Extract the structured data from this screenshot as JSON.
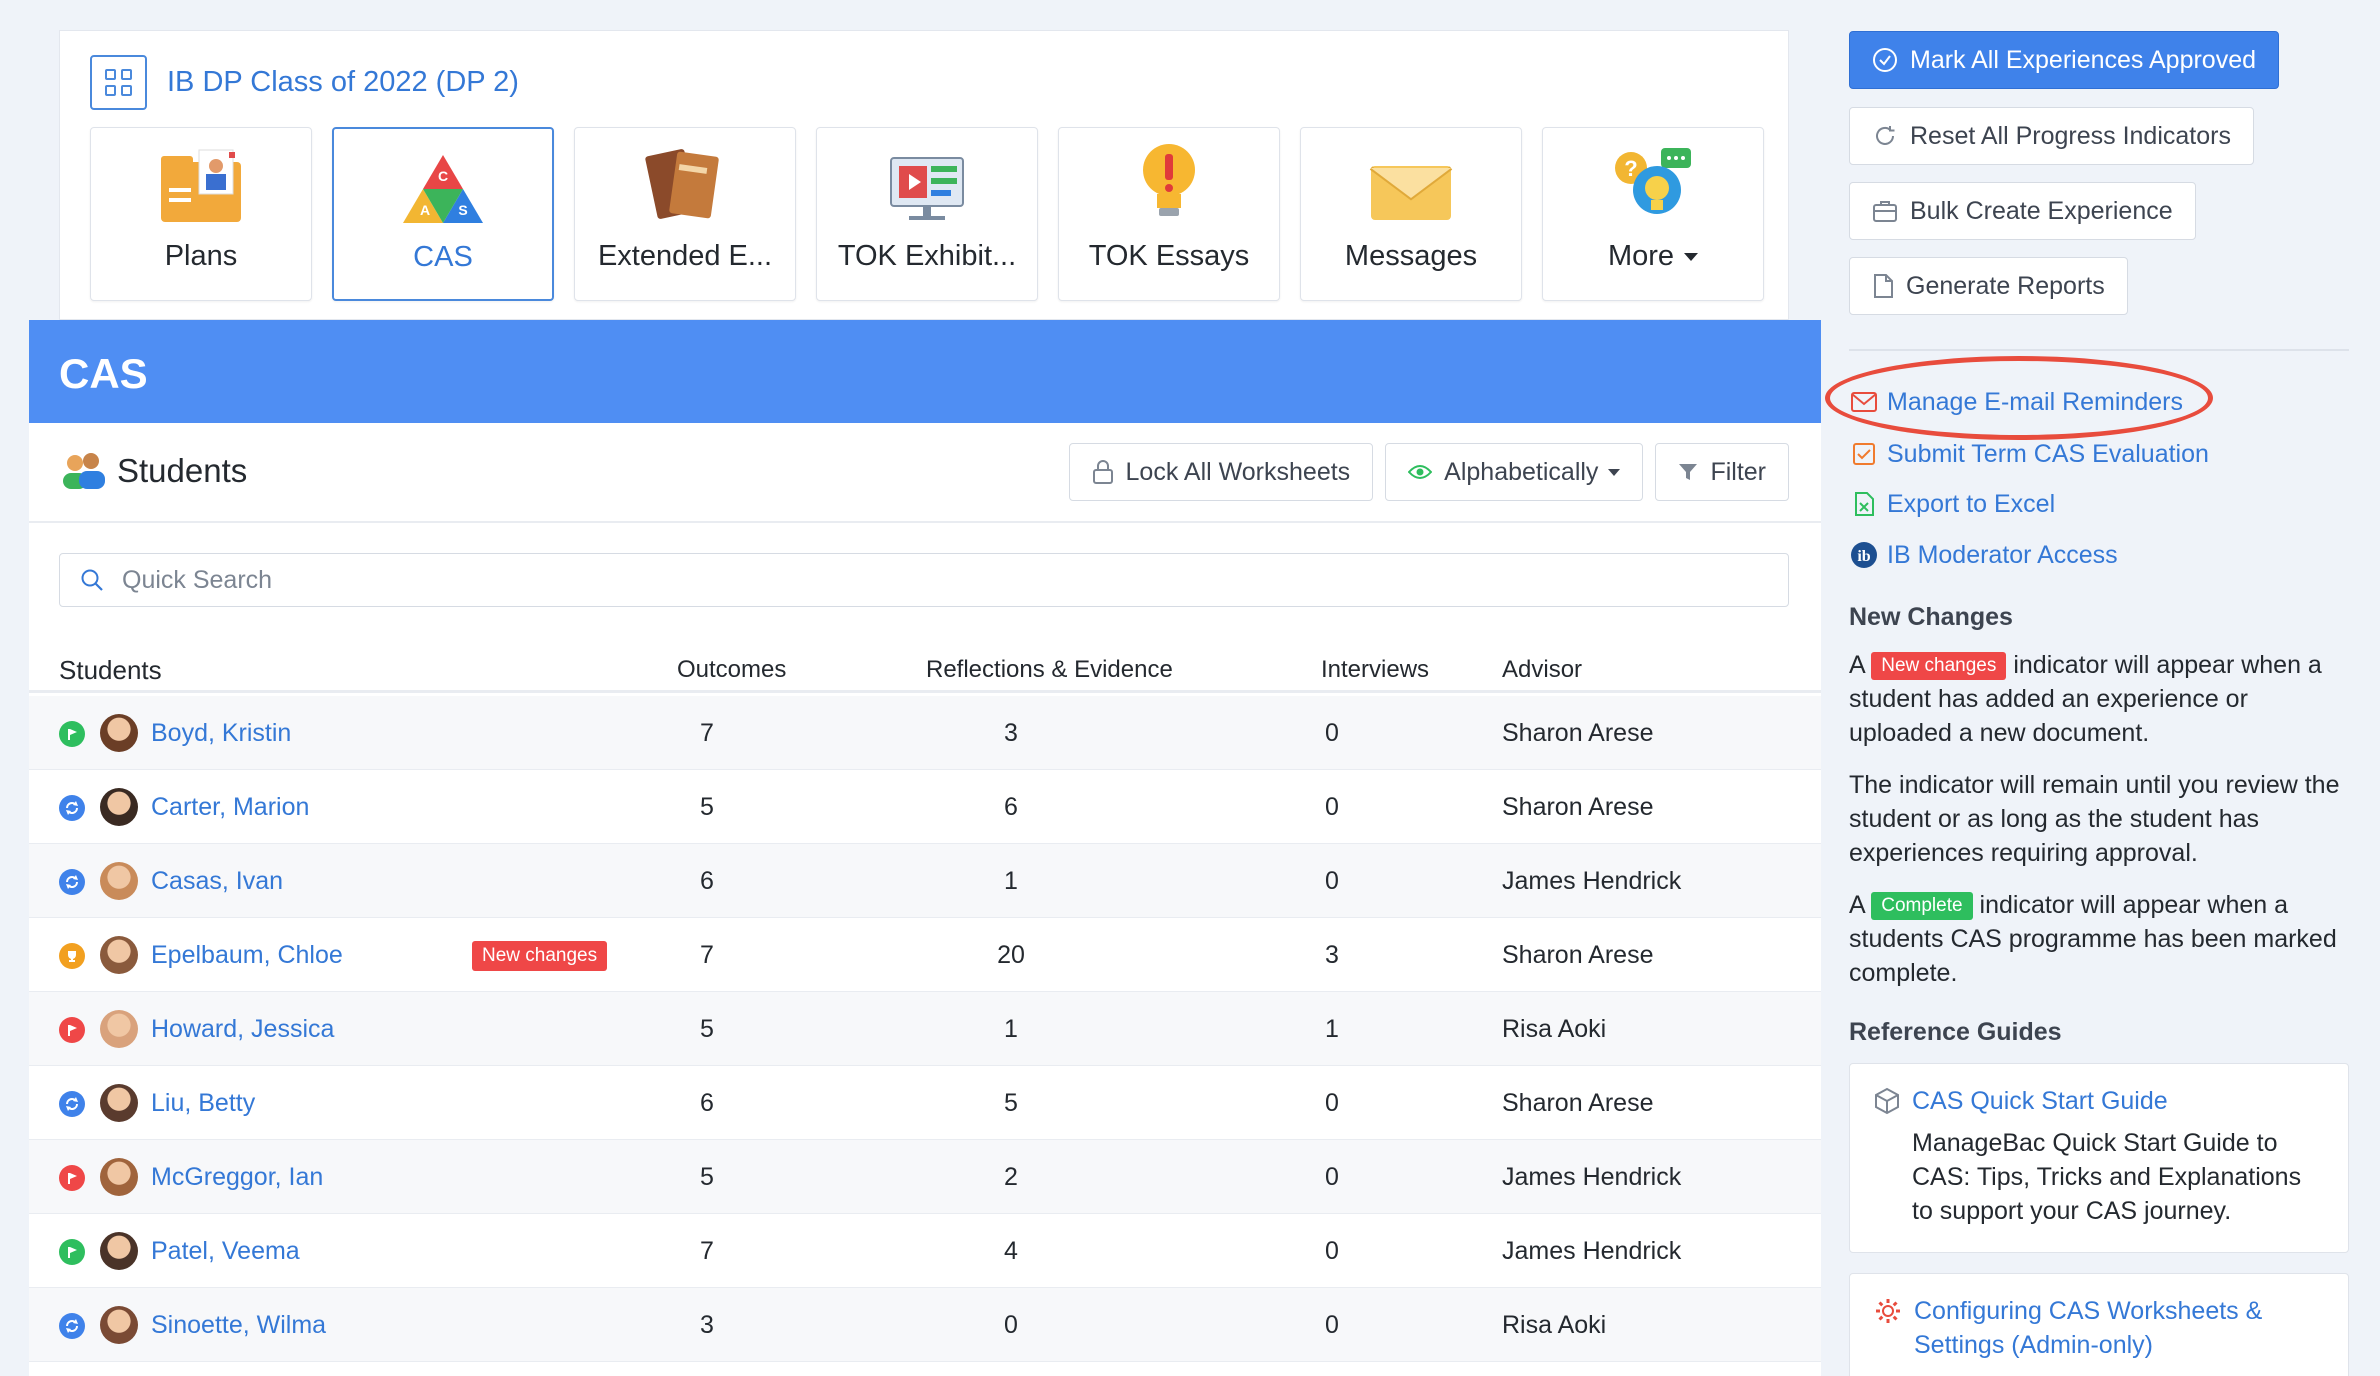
{
  "class": {
    "title": "IB DP Class of 2022 (DP 2)"
  },
  "tiles": [
    {
      "label": "Plans",
      "icon": "plans-folder-icon"
    },
    {
      "label": "CAS",
      "icon": "cas-triangle-icon"
    },
    {
      "label": "Extended E...",
      "icon": "extended-essay-books-icon"
    },
    {
      "label": "TOK Exhibit...",
      "icon": "tok-exhibition-screen-icon"
    },
    {
      "label": "TOK Essays",
      "icon": "lightbulb-icon"
    },
    {
      "label": "Messages",
      "icon": "envelope-icon"
    },
    {
      "label": "More",
      "icon": "question-bubble-icon"
    }
  ],
  "cas": {
    "title": "CAS",
    "students_heading": "Students",
    "toolbar": {
      "lock": "Lock All Worksheets",
      "sort": "Alphabetically",
      "filter": "Filter"
    },
    "search_placeholder": "Quick Search",
    "columns": {
      "students": "Students",
      "outcomes": "Outcomes",
      "reflections": "Reflections & Evidence",
      "interviews": "Interviews",
      "advisor": "Advisor"
    },
    "rows": [
      {
        "status": "green-flag",
        "name": "Boyd, Kristin",
        "badge": "",
        "outcomes": "7",
        "reflections": "3",
        "interviews": "0",
        "advisor": "Sharon Arese"
      },
      {
        "status": "blue-sync",
        "name": "Carter, Marion",
        "badge": "",
        "outcomes": "5",
        "reflections": "6",
        "interviews": "0",
        "advisor": "Sharon Arese"
      },
      {
        "status": "blue-sync",
        "name": "Casas, Ivan",
        "badge": "",
        "outcomes": "6",
        "reflections": "1",
        "interviews": "0",
        "advisor": "James Hendrick"
      },
      {
        "status": "orange-trophy",
        "name": "Epelbaum, Chloe",
        "badge": "New changes",
        "outcomes": "7",
        "reflections": "20",
        "interviews": "3",
        "advisor": "Sharon Arese"
      },
      {
        "status": "red-flag",
        "name": "Howard, Jessica",
        "badge": "",
        "outcomes": "5",
        "reflections": "1",
        "interviews": "1",
        "advisor": "Risa Aoki"
      },
      {
        "status": "blue-sync",
        "name": "Liu, Betty",
        "badge": "",
        "outcomes": "6",
        "reflections": "5",
        "interviews": "0",
        "advisor": "Sharon Arese"
      },
      {
        "status": "red-flag",
        "name": "McGreggor, Ian",
        "badge": "",
        "outcomes": "5",
        "reflections": "2",
        "interviews": "0",
        "advisor": "James Hendrick"
      },
      {
        "status": "green-flag",
        "name": "Patel, Veema",
        "badge": "",
        "outcomes": "7",
        "reflections": "4",
        "interviews": "0",
        "advisor": "James Hendrick"
      },
      {
        "status": "blue-sync",
        "name": "Sinoette, Wilma",
        "badge": "",
        "outcomes": "3",
        "reflections": "0",
        "interviews": "0",
        "advisor": "Risa Aoki"
      }
    ]
  },
  "sidebar": {
    "actions": {
      "approve": "Mark All Experiences Approved",
      "reset": "Reset All Progress Indicators",
      "bulk": "Bulk Create Experience",
      "reports": "Generate Reports"
    },
    "links": {
      "reminders": "Manage E-mail Reminders",
      "term_eval": "Submit Term CAS Evaluation",
      "excel": "Export to Excel",
      "moderator": "IB Moderator Access"
    },
    "new_changes": {
      "title": "New Changes",
      "p1_a": "A",
      "p1_badge": "New changes",
      "p1_b": "indicator will appear when a student has added an experience or uploaded a new document.",
      "p2": "The indicator will remain until you review the student or as long as the student has experiences requiring approval.",
      "p3_a": "A",
      "p3_badge": "Complete",
      "p3_b": "indicator will appear when a students CAS programme has been marked complete."
    },
    "reference": {
      "title": "Reference Guides",
      "guide1_title": "CAS Quick Start Guide",
      "guide1_desc": "ManageBac Quick Start Guide to CAS: Tips, Tricks and Explanations to support your CAS journey.",
      "guide2_title": "Configuring CAS Worksheets & Settings (Admin-only)"
    }
  },
  "colors": {
    "accent": "#3478d6",
    "header": "#4f8ef3",
    "primary_button": "#3f82ea",
    "danger": "#ef4747",
    "success": "#2ebe5e",
    "highlight_ring": "#e84c3d"
  }
}
